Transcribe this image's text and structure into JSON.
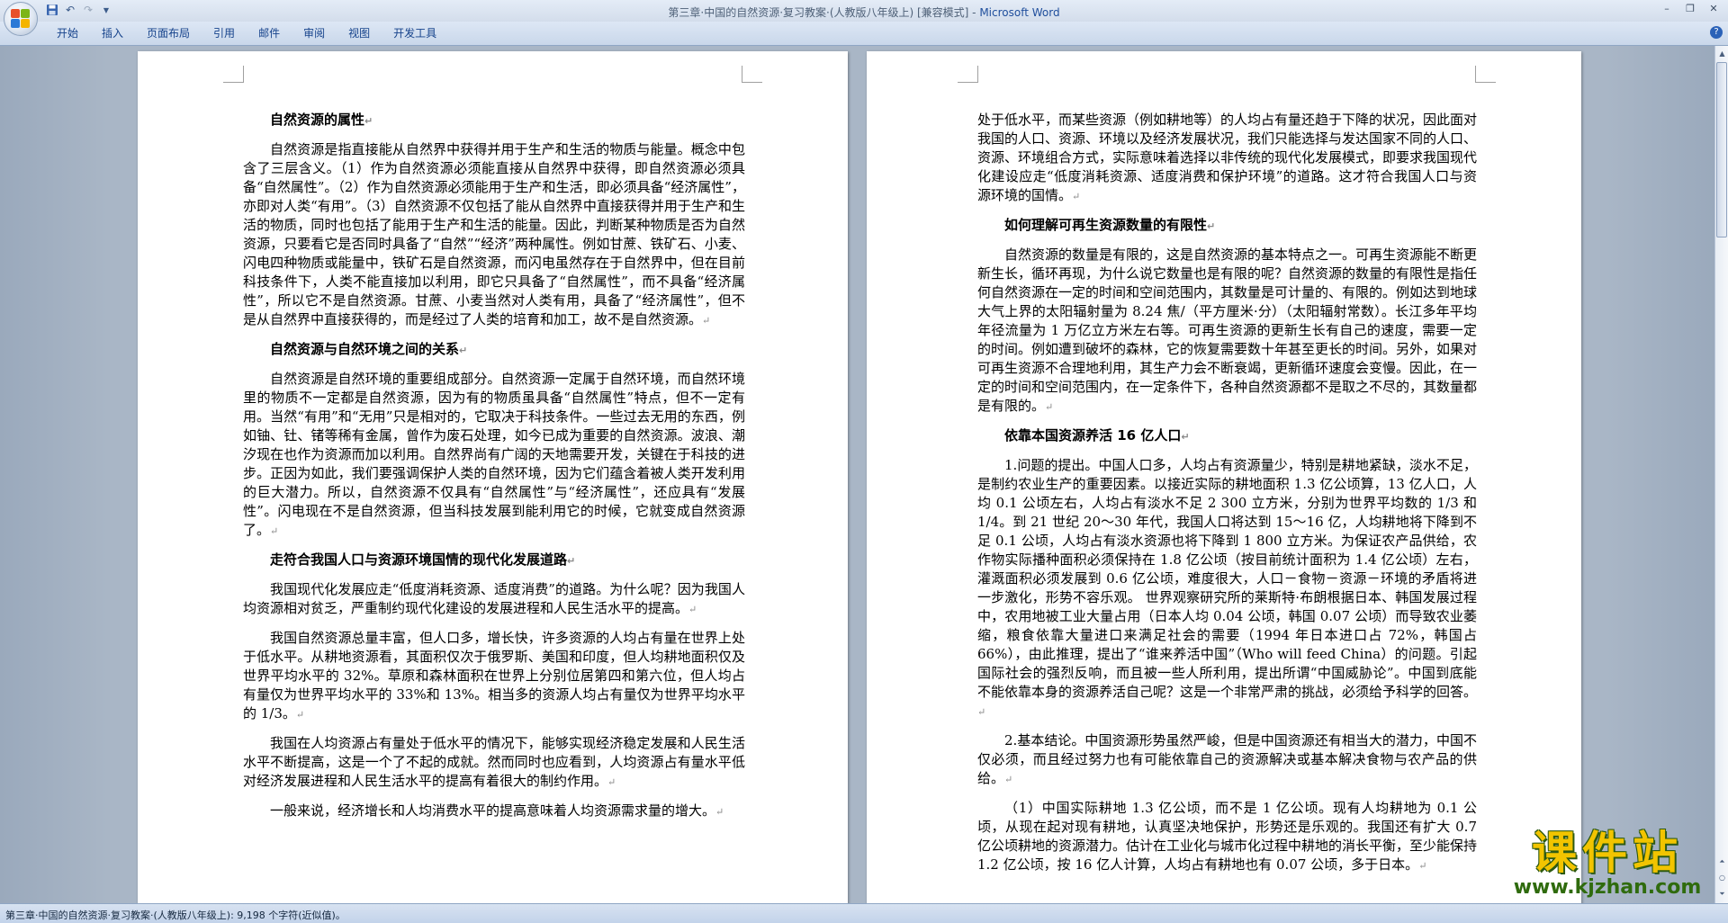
{
  "window": {
    "title": "第三章·中国的自然资源·复习教案·(人教版八年级上) [兼容模式] - ",
    "app_name": "Microsoft Word"
  },
  "icons": {
    "office_button": "office-logo-icon",
    "save": "save-icon",
    "undo": "undo-icon",
    "redo": "redo-icon",
    "customize": "chevron-down-icon"
  },
  "ribbon": {
    "tabs": [
      "开始",
      "插入",
      "页面布局",
      "引用",
      "邮件",
      "审阅",
      "视图",
      "开发工具"
    ]
  },
  "colors": {
    "accent": "#15428b",
    "watermark_yellow": "#f2c400",
    "watermark_green": "#2f6b0d"
  },
  "pages": {
    "left": {
      "blocks": [
        {
          "type": "heading",
          "text": "自然资源的属性"
        },
        {
          "type": "para",
          "text": "自然资源是指直接能从自然界中获得并用于生产和生活的物质与能量。概念中包含了三层含义。（1）作为自然资源必须能直接从自然界中获得，即自然资源必须具备“自然属性”。（2）作为自然资源必须能用于生产和生活，即必须具备“经济属性”，亦即对人类“有用”。（3）自然资源不仅包括了能从自然界中直接获得并用于生产和生活的物质，同时也包括了能用于生产和生活的能量。因此，判断某种物质是否为自然资源，只要看它是否同时具备了“自然”“经济”两种属性。例如甘蔗、铁矿石、小麦、闪电四种物质或能量中，铁矿石是自然资源，而闪电虽然存在于自然界中，但在目前科技条件下，人类不能直接加以利用，即它只具备了“自然属性”，而不具备“经济属性”，所以它不是自然资源。甘蔗、小麦当然对人类有用，具备了“经济属性”，但不是从自然界中直接获得的，而是经过了人类的培育和加工，故不是自然资源。"
        },
        {
          "type": "heading",
          "text": "自然资源与自然环境之间的关系"
        },
        {
          "type": "para",
          "text": "自然资源是自然环境的重要组成部分。自然资源一定属于自然环境，而自然环境里的物质不一定都是自然资源，因为有的物质虽具备“自然属性”特点，但不一定有用。当然“有用”和“无用”只是相对的，它取决于科技条件。一些过去无用的东西，例如铀、钍、锗等稀有金属，曾作为废石处理，如今已成为重要的自然资源。波浪、潮汐现在也作为资源而加以利用。自然界尚有广阔的天地需要开发，关键在于科技的进步。正因为如此，我们要强调保护人类的自然环境，因为它们蕴含着被人类开发利用的巨大潜力。所以，自然资源不仅具有“自然属性”与“经济属性”，还应具有“发展性”。闪电现在不是自然资源，但当科技发展到能利用它的时候，它就变成自然资源了。"
        },
        {
          "type": "heading",
          "text": "走符合我国人口与资源环境国情的现代化发展道路"
        },
        {
          "type": "para",
          "text": "我国现代化发展应走“低度消耗资源、适度消费”的道路。为什么呢？因为我国人均资源相对贫乏，严重制约现代化建设的发展进程和人民生活水平的提高。"
        },
        {
          "type": "para",
          "text": "我国自然资源总量丰富，但人口多，增长快，许多资源的人均占有量在世界上处于低水平。从耕地资源看，其面积仅次于俄罗斯、美国和印度，但人均耕地面积仅及世界平均水平的 32%。草原和森林面积在世界上分别位居第四和第六位，但人均占有量仅为世界平均水平的 33%和 13%。相当多的资源人均占有量仅为世界平均水平的 1/3。"
        },
        {
          "type": "para",
          "text": "我国在人均资源占有量处于低水平的情况下，能够实现经济稳定发展和人民生活水平不断提高，这是一个了不起的成就。然而同时也应看到，人均资源占有量水平低对经济发展进程和人民生活水平的提高有着很大的制约作用。"
        },
        {
          "type": "para",
          "text": "一般来说，经济增长和人均消费水平的提高意味着人均资源需求量的增大。"
        }
      ]
    },
    "right": {
      "blocks": [
        {
          "type": "cont",
          "text": "处于低水平，而某些资源（例如耕地等）的人均占有量还趋于下降的状况，因此面对我国的人口、资源、环境以及经济发展状况，我们只能选择与发达国家不同的人口、资源、环境组合方式，实际意味着选择以非传统的现代化发展模式，即要求我国现代化建设应走“低度消耗资源、适度消费和保护环境”的道路。这才符合我国人口与资源环境的国情。"
        },
        {
          "type": "heading",
          "text": "如何理解可再生资源数量的有限性"
        },
        {
          "type": "para",
          "text": "自然资源的数量是有限的，这是自然资源的基本特点之一。可再生资源能不断更新生长，循环再现，为什么说它数量也是有限的呢？自然资源的数量的有限性是指任何自然资源在一定的时间和空间范围内，其数量是可计量的、有限的。例如达到地球大气上界的太阳辐射量为 8.24 焦/（平方厘米·分）（太阳辐射常数）。长江多年平均年径流量为 1 万亿立方米左右等。可再生资源的更新生长有自己的速度，需要一定的时间。例如遭到破坏的森林，它的恢复需要数十年甚至更长的时间。另外，如果对可再生资源不合理地利用，其生产力会不断衰竭，更新循环速度会变慢。因此，在一定的时间和空间范围内，在一定条件下，各种自然资源都不是取之不尽的，其数量都是有限的。"
        },
        {
          "type": "heading",
          "text": "依靠本国资源养活 16 亿人口"
        },
        {
          "type": "para",
          "text": "1.问题的提出。中国人口多，人均占有资源量少，特别是耕地紧缺，淡水不足，是制约农业生产的重要因素。以接近实际的耕地面积 1.3 亿公顷算，13 亿人口，人均 0.1 公顷左右，人均占有淡水不足 2 300 立方米，分别为世界平均数的 1/3 和 1/4。到 21 世纪 20～30 年代，我国人口将达到 15～16 亿，人均耕地将下降到不足 0.1 公顷，人均占有淡水资源也将下降到 1 800 立方米。为保证农产品供给，农作物实际播种面积必须保持在 1.8 亿公顷（按目前统计面积为 1.4 亿公顷）左右，灌溉面积必须发展到 0.6 亿公顷，难度很大，人口－食物－资源－环境的矛盾将进一步激化，形势不容乐观。 世界观察研究所的莱斯特·布朗根据日本、韩国发展过程中，农用地被工业大量占用（日本人均 0.04 公顷，韩国 0.07 公顷）而导致农业萎缩，粮食依靠大量进口来满足社会的需要（1994 年日本进口占 72%，韩国占 66%），由此推理，提出了“谁来养活中国”（Who will feed China）的问题。引起国际社会的强烈反响，而且被一些人所利用，提出所谓“中国威胁论”。中国到底能不能依靠本身的资源养活自己呢？这是一个非常严肃的挑战，必须给予科学的回答。"
        },
        {
          "type": "para",
          "text": "2.基本结论。中国资源形势虽然严峻，但是中国资源还有相当大的潜力，中国不仅必须，而且经过努力也有可能依靠自己的资源解决或基本解决食物与农产品的供给。"
        },
        {
          "type": "para",
          "text": "（1）中国实际耕地 1.3 亿公顷，而不是 1 亿公顷。现有人均耕地为 0.1 公顷，从现在起对现有耕地，认真坚决地保护，形势还是乐观的。我国还有扩大 0.7 亿公顷耕地的资源潜力。估计在工业化与城市化过程中耕地的消长平衡，至少能保持 1.2 亿公顷，按 16 亿人计算，人均占有耕地也有 0.07 公顷，多于日本。"
        }
      ]
    }
  },
  "paragraph_mark": "↵",
  "watermark": {
    "text": "课件站",
    "url": "www.kjzhan.com"
  },
  "statusbar": {
    "text": "第三章·中国的自然资源·复习教案·(人教版八年级上): 9,198 个字符(近似值)。"
  }
}
